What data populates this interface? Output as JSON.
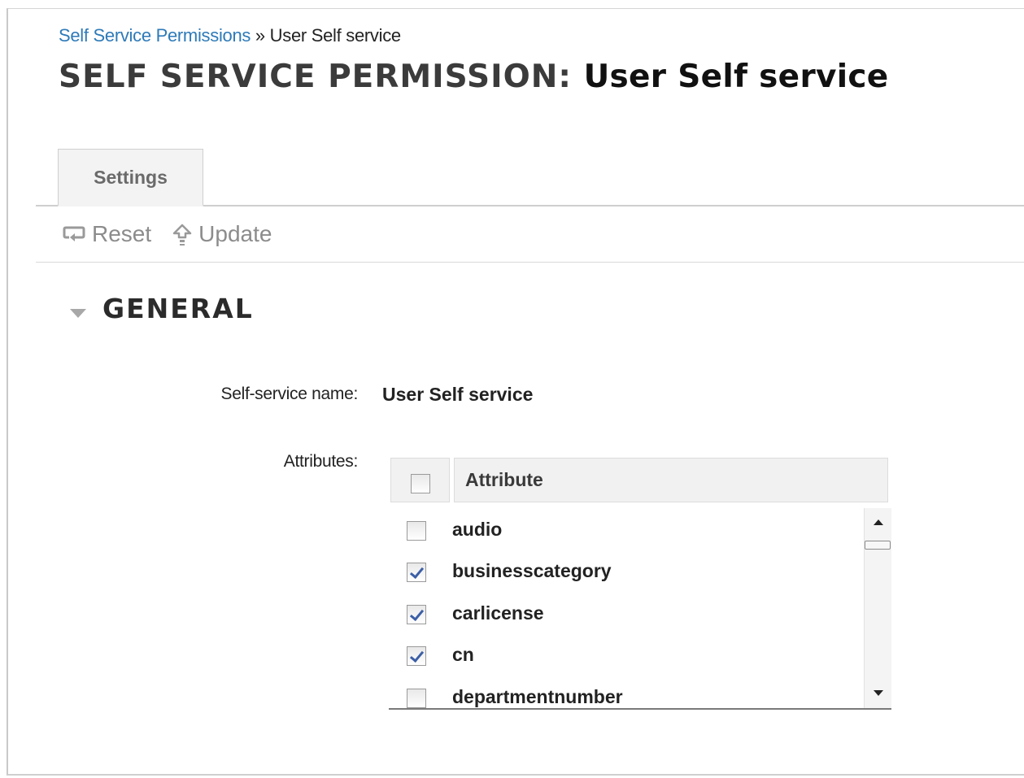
{
  "breadcrumb": {
    "parent_link": "Self Service Permissions",
    "separator": "»",
    "current": "User Self service"
  },
  "page_title": {
    "prefix": "SELF SERVICE PERMISSION:",
    "entity": "User Self service"
  },
  "tabs": [
    {
      "label": "Settings",
      "active": true
    }
  ],
  "toolbar": {
    "reset_label": "Reset",
    "reset_icon": "reset-icon",
    "update_label": "Update",
    "update_icon": "update-arrow-icon"
  },
  "section": {
    "title": "GENERAL",
    "expanded": true
  },
  "fields": {
    "name_label": "Self-service name:",
    "name_value": "User Self service",
    "attributes_label": "Attributes:"
  },
  "attributes_table": {
    "header": "Attribute",
    "select_all_checked": false,
    "rows": [
      {
        "name": "audio",
        "checked": false
      },
      {
        "name": "businesscategory",
        "checked": true
      },
      {
        "name": "carlicense",
        "checked": true
      },
      {
        "name": "cn",
        "checked": true
      },
      {
        "name": "departmentnumber",
        "checked": false
      }
    ]
  },
  "colors": {
    "link": "#2e7ab8",
    "check_mark": "#3b5fa6",
    "toolbar_text": "#8c8c8c"
  }
}
